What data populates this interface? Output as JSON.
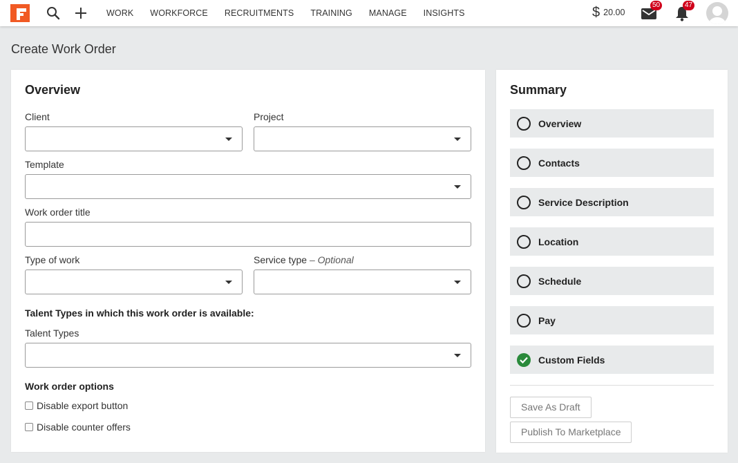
{
  "nav": {
    "links": [
      "WORK",
      "WORKFORCE",
      "RECRUITMENTS",
      "TRAINING",
      "MANAGE",
      "INSIGHTS"
    ],
    "balance": "20.00",
    "messages_count": "50",
    "notifications_count": "47",
    "brand_color": "#f15a24"
  },
  "page": {
    "title": "Create Work Order"
  },
  "overview": {
    "title": "Overview",
    "client_label": "Client",
    "project_label": "Project",
    "template_label": "Template",
    "work_order_title_label": "Work order title",
    "type_of_work_label": "Type of work",
    "service_type_label": "Service type",
    "service_type_optional": "– Optional",
    "talent_heading": "Talent Types in which this work order is available:",
    "talent_types_label": "Talent Types",
    "options_heading": "Work order options",
    "option_disable_export": "Disable export button",
    "option_disable_counter": "Disable counter offers"
  },
  "summary": {
    "title": "Summary",
    "items": [
      {
        "label": "Overview",
        "done": false
      },
      {
        "label": "Contacts",
        "done": false
      },
      {
        "label": "Service Description",
        "done": false
      },
      {
        "label": "Location",
        "done": false
      },
      {
        "label": "Schedule",
        "done": false
      },
      {
        "label": "Pay",
        "done": false
      },
      {
        "label": "Custom Fields",
        "done": true
      }
    ],
    "save_draft": "Save As Draft",
    "publish": "Publish To Marketplace",
    "check_color": "#2a8a3b"
  }
}
